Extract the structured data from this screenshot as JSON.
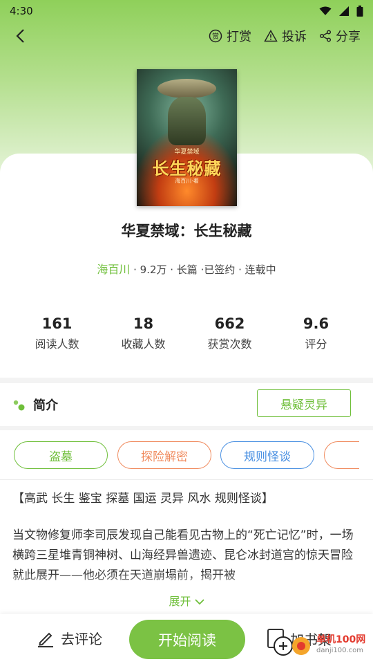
{
  "status_bar": {
    "time": "4:30"
  },
  "top_bar": {
    "reward_label": "打赏",
    "reward_icon_char": "赏",
    "report_label": "投诉",
    "share_label": "分享"
  },
  "book": {
    "cover": {
      "small_title": "华夏禁域",
      "big_title": "长生秘藏",
      "cover_author": "海百川·著"
    },
    "title": "华夏禁域：长生秘藏",
    "author": "海百川",
    "meta_rest": " · 9.2万 · 长篇 ·已签约 · 连载中"
  },
  "stats": [
    {
      "value": "161",
      "label": "阅读人数"
    },
    {
      "value": "18",
      "label": "收藏人数"
    },
    {
      "value": "662",
      "label": "获赏次数"
    },
    {
      "value": "9.6",
      "label": "评分"
    }
  ],
  "intro": {
    "label": "简介",
    "genre_button": "悬疑灵异"
  },
  "tags": [
    {
      "label": "盗墓",
      "color": "#6fbf3a"
    },
    {
      "label": "探险解密",
      "color": "#f08a5d"
    },
    {
      "label": "规则怪谈",
      "color": "#4a90e2"
    },
    {
      "label": "",
      "color": "#f08a5d"
    }
  ],
  "keywords": "【高武 长生 鉴宝 探墓 国运 灵异 风水 规则怪谈】",
  "description": "当文物修复师李司辰发现自己能看见古物上的“死亡记忆”时，一场横跨三星堆青铜神树、山海经异兽遗迹、昆仑冰封道宫的惊天冒险就此展开——他必须在天道崩塌前，揭开被",
  "expand_label": "展开",
  "bottom_bar": {
    "comment_label": "去评论",
    "read_label": "开始阅读",
    "shelf_label": "加书架"
  },
  "watermark": {
    "site_name": "单机100网",
    "domain": "danji100.com"
  },
  "colors": {
    "accent": "#7bc244",
    "header_top": "#8fd05a"
  }
}
